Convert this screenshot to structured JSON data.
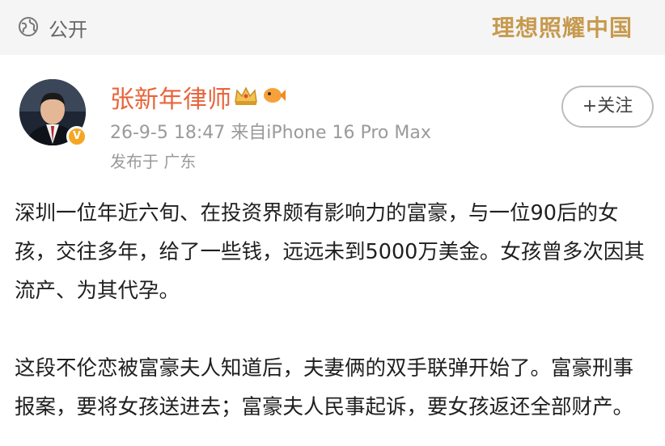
{
  "header": {
    "visibility_label": "公开",
    "slogan": "理想照耀中国"
  },
  "post": {
    "author_name": "张新年律师",
    "verified_badge": "V",
    "meta": "26-9-5 18:47  来自iPhone 16 Pro Max",
    "location": "发布于 广东",
    "follow_label": "+关注",
    "paragraphs": [
      "深圳一位年近六旬、在投资界颇有影响力的富豪，与一位90后的女孩，交往多年，给了一些钱，远远未到5000万美金。女孩曾多次因其流产、为其代孕。",
      "这段不伦恋被富豪夫人知道后，夫妻俩的双手联弹开始了。富豪刑事报案，要将女孩送进去；富豪夫人民事起诉，要女孩返还全部财产。"
    ]
  },
  "icons": {
    "visibility": "globe-icon",
    "author_badges": [
      "crown-icon",
      "fish-icon"
    ]
  },
  "colors": {
    "author_name": "#e8643a",
    "slogan": "#c79a4e",
    "verified_badge": "#f5a623"
  }
}
